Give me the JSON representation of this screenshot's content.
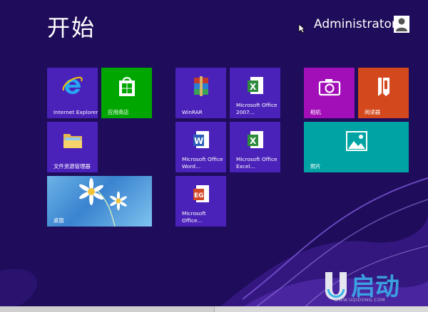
{
  "start_title": "开始",
  "user_name": "Administrator",
  "tiles": {
    "ie": "Internet Explorer",
    "store": "应用商店",
    "explorer": "文件资源管理器",
    "desktop": "桌面",
    "winrar": "WinRAR",
    "excel2007": "Microsoft Office 2007...",
    "word": "Microsoft Office Word...",
    "excel": "Microsoft Office Excel...",
    "ppt": "Microsoft Office...",
    "camera": "相机",
    "reader": "阅读器",
    "photos": "照片"
  },
  "watermark": {
    "text": "启动",
    "url": "WWW.UQIDONG.COM"
  },
  "colors": {
    "background": "#1f0c5a",
    "tile_blue": "#4b22b9",
    "tile_green": "#00a600",
    "tile_magenta": "#a20fb8",
    "tile_orange": "#d4481e",
    "tile_teal": "#00a3a3"
  }
}
